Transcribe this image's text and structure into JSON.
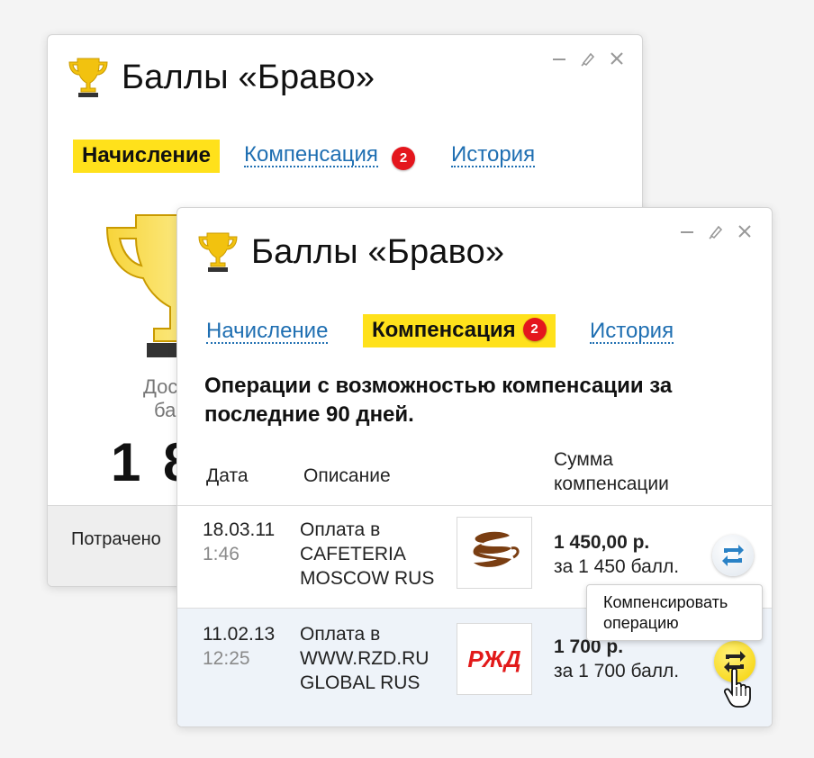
{
  "back_window": {
    "title": "Баллы «Браво»",
    "tabs": [
      {
        "label": "Начисление",
        "active": true
      },
      {
        "label": "Компенсация",
        "badge": "2",
        "active": false
      },
      {
        "label": "История",
        "active": false
      }
    ],
    "partial_text_1": "Дос",
    "partial_text_2": "ба",
    "big_number": "1 8",
    "footer_text": "Потрачено"
  },
  "front_window": {
    "title": "Баллы «Браво»",
    "tabs": [
      {
        "label": "Начисление",
        "active": false
      },
      {
        "label": "Компенсация",
        "badge": "2",
        "active": true
      },
      {
        "label": "История",
        "active": false
      }
    ],
    "heading_line1": "Операции с возможностью компенсации за",
    "heading_line2": "последние 90 дней.",
    "columns": {
      "date": "Дата",
      "description": "Описание",
      "amount_line1": "Сумма",
      "amount_line2": "компенсации"
    },
    "rows": [
      {
        "date": "18.03.11",
        "time": "1:46",
        "desc": [
          "Оплата в",
          "CAFETERIA",
          "MOSCOW RUS"
        ],
        "logo": "coffee-cup-logo",
        "amount": "1 450,00 р.",
        "points": "за 1 450 балл."
      },
      {
        "date": "11.02.13",
        "time": "12:25",
        "desc": [
          "Оплата в",
          "WWW.RZD.RU",
          "GLOBAL RUS"
        ],
        "logo": "rzd-logo",
        "logo_text": "РЖД",
        "amount": "1 700 р.",
        "points": "за 1 700 балл."
      }
    ],
    "tooltip_line1": "Компенсировать",
    "tooltip_line2": "операцию"
  },
  "colors": {
    "accent_yellow": "#ffe11b",
    "link_blue": "#1f6fb2",
    "badge_red": "#e4161d",
    "rzd_red": "#e21a1a"
  }
}
